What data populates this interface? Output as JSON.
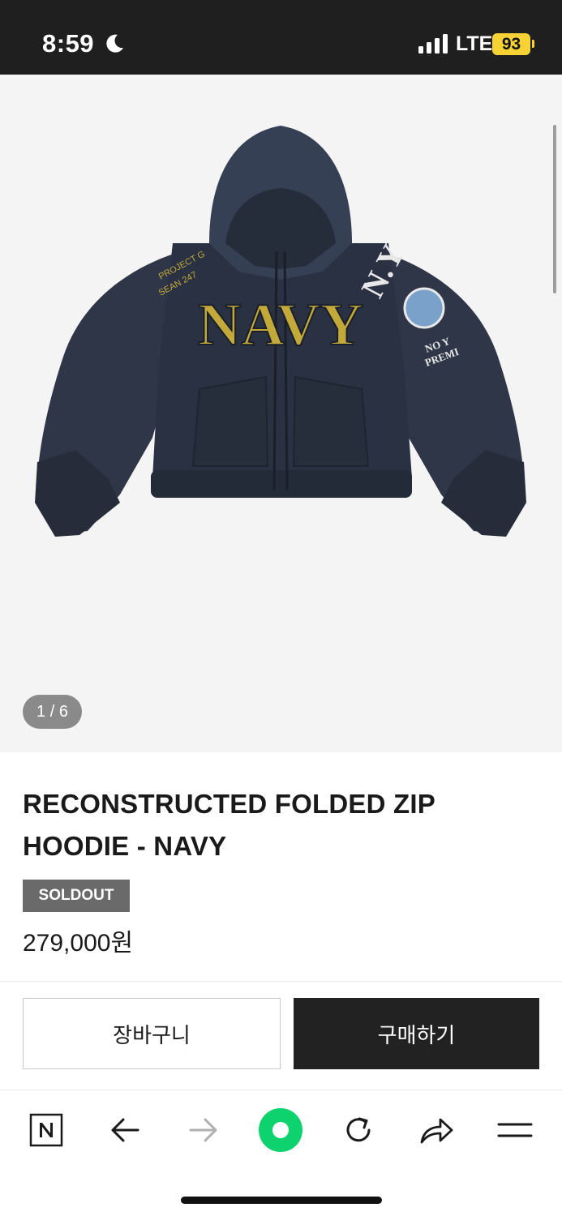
{
  "status_bar": {
    "time": "8:59",
    "network": "LTE",
    "battery": "93",
    "icons": [
      "moon-icon",
      "signal-icon",
      "battery-icon"
    ]
  },
  "gallery": {
    "current_page": 1,
    "total_pages": 6,
    "indicator": "1 / 6",
    "image_subject": "navy zip hoodie"
  },
  "product": {
    "title": "RECONSTRUCTED FOLDED ZIP HOODIE - NAVY",
    "badge": "SOLDOUT",
    "price": "279,000원"
  },
  "actions": {
    "cart_label": "장바구니",
    "buy_label": "구매하기"
  },
  "browser_toolbar": {
    "icons": [
      "naver-n-icon",
      "back-arrow-icon",
      "forward-arrow-icon",
      "green-dot-icon",
      "refresh-icon",
      "share-icon",
      "menu-icon"
    ]
  },
  "colors": {
    "status_bar_bg": "#1f1f1f",
    "battery": "#f6d234",
    "gallery_bg": "#f4f4f4",
    "badge_bg": "#6a6a6a",
    "buy_button_bg": "#222222",
    "green_accent": "#0ed26e",
    "hoodie_navy": "#2e3647",
    "hoodie_lettering": "#c2a93a"
  }
}
